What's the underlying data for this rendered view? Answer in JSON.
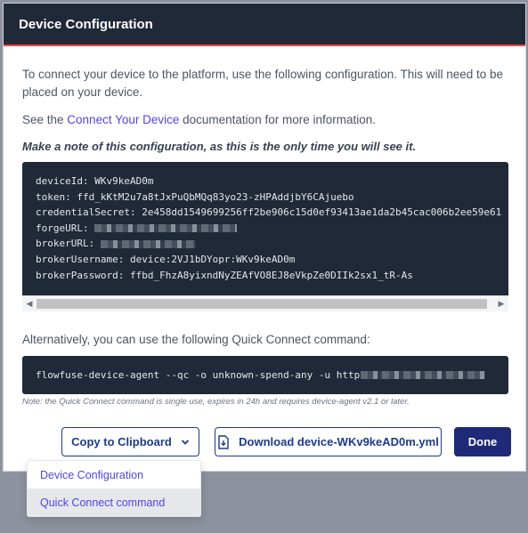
{
  "dialog": {
    "title": "Device Configuration",
    "intro": "To connect your device to the platform, use the following configuration. This will need to be placed on your device.",
    "see_prefix": "See the ",
    "see_link": "Connect Your Device",
    "see_suffix": " documentation for more information.",
    "warning": "Make a note of this configuration, as this is the only time you will see it."
  },
  "config": {
    "lines": [
      {
        "key": "deviceId:",
        "value": "WKv9keAD0m"
      },
      {
        "key": "token:",
        "value": "ffd_kKtM2u7a8tJxPuQbMQq83yo23-zHPAddjbY6CAjuebo"
      },
      {
        "key": "credentialSecret:",
        "value": "2e458dd1549699256ff2be906c15d0ef93413ae1da2b45cac006b2ee59e61"
      },
      {
        "key": "forgeURL:",
        "value": ""
      },
      {
        "key": "brokerURL:",
        "value": ""
      },
      {
        "key": "brokerUsername:",
        "value": "device:2VJ1bDYopr:WKv9keAD0m"
      },
      {
        "key": "brokerPassword:",
        "value": "ffbd_FhzA8yixndNyZEAfVO8EJ8eVkpZe0DIIk2sx1_tR-As"
      }
    ]
  },
  "quick_connect": {
    "intro": "Alternatively, you can use the following Quick Connect command:",
    "command": "flowfuse-device-agent --qc -o unknown-spend-any -u http",
    "note": "Note: the Quick Connect command is single use, expires in 24h and requires device-agent v2.1 or later."
  },
  "buttons": {
    "copy": "Copy to Clipboard",
    "download": "Download device-WKv9keAD0m.yml",
    "done": "Done"
  },
  "dropdown": {
    "items": [
      "Device Configuration",
      "Quick Connect command"
    ],
    "highlighted_index": 1
  },
  "colors": {
    "header_bg": "#1f2937",
    "header_accent": "#ef4444",
    "primary": "#1e2a78",
    "link": "#4f46e5"
  },
  "icons": {
    "copy_chevron": "chevron-down-icon",
    "download": "download-file-icon",
    "scroll_left": "scroll-left-arrow",
    "scroll_right": "scroll-right-arrow"
  }
}
